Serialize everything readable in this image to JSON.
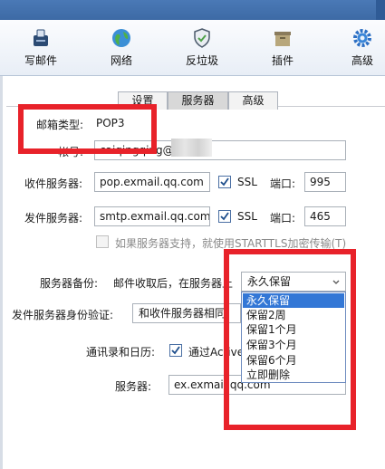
{
  "toolbar": {
    "items": [
      {
        "label": "写邮件",
        "icon": "compose-icon"
      },
      {
        "label": "网络",
        "icon": "globe-icon"
      },
      {
        "label": "反垃圾",
        "icon": "shield-icon"
      },
      {
        "label": "插件",
        "icon": "box-icon"
      },
      {
        "label": "高级",
        "icon": "gear-icon"
      }
    ]
  },
  "tabs": [
    {
      "label": "设置",
      "active": false
    },
    {
      "label": "服务器",
      "active": true
    },
    {
      "label": "高级",
      "active": false
    }
  ],
  "form": {
    "mailbox_type_label": "邮箱类型:",
    "mailbox_type_value": "POP3",
    "account_label": "帐号:",
    "account_value": "caiqingqing@",
    "incoming_label": "收件服务器:",
    "incoming_value": "pop.exmail.qq.com",
    "incoming_ssl_label": "SSL",
    "incoming_ssl_checked": true,
    "incoming_port_label": "端口:",
    "incoming_port_value": "995",
    "outgoing_label": "发件服务器:",
    "outgoing_value": "smtp.exmail.qq.com",
    "outgoing_ssl_label": "SSL",
    "outgoing_ssl_checked": true,
    "outgoing_port_label": "端口:",
    "outgoing_port_value": "465",
    "starttls_label": "如果服务器支持，就使用STARTTLS加密传输(T)",
    "starttls_checked": false,
    "backup_label": "服务器备份:",
    "backup_desc": "邮件收取后，在服务器上",
    "backup_selected": "永久保留",
    "backup_options": [
      "永久保留",
      "保留2周",
      "保留1个月",
      "保留3个月",
      "保留6个月",
      "立即删除"
    ],
    "outgoing_auth_label": "发件服务器身份验证:",
    "outgoing_auth_value": "和收件服务器相同",
    "contacts_label": "通讯录和日历:",
    "contacts_option_label": "通过Active",
    "contacts_checked": true,
    "server_label": "服务器:",
    "server_value": "ex.exmail.qq.com"
  },
  "colors": {
    "highlight_box": "#e8222a",
    "selected_option": "#3377d6",
    "title_bar": "#4a79b6"
  }
}
